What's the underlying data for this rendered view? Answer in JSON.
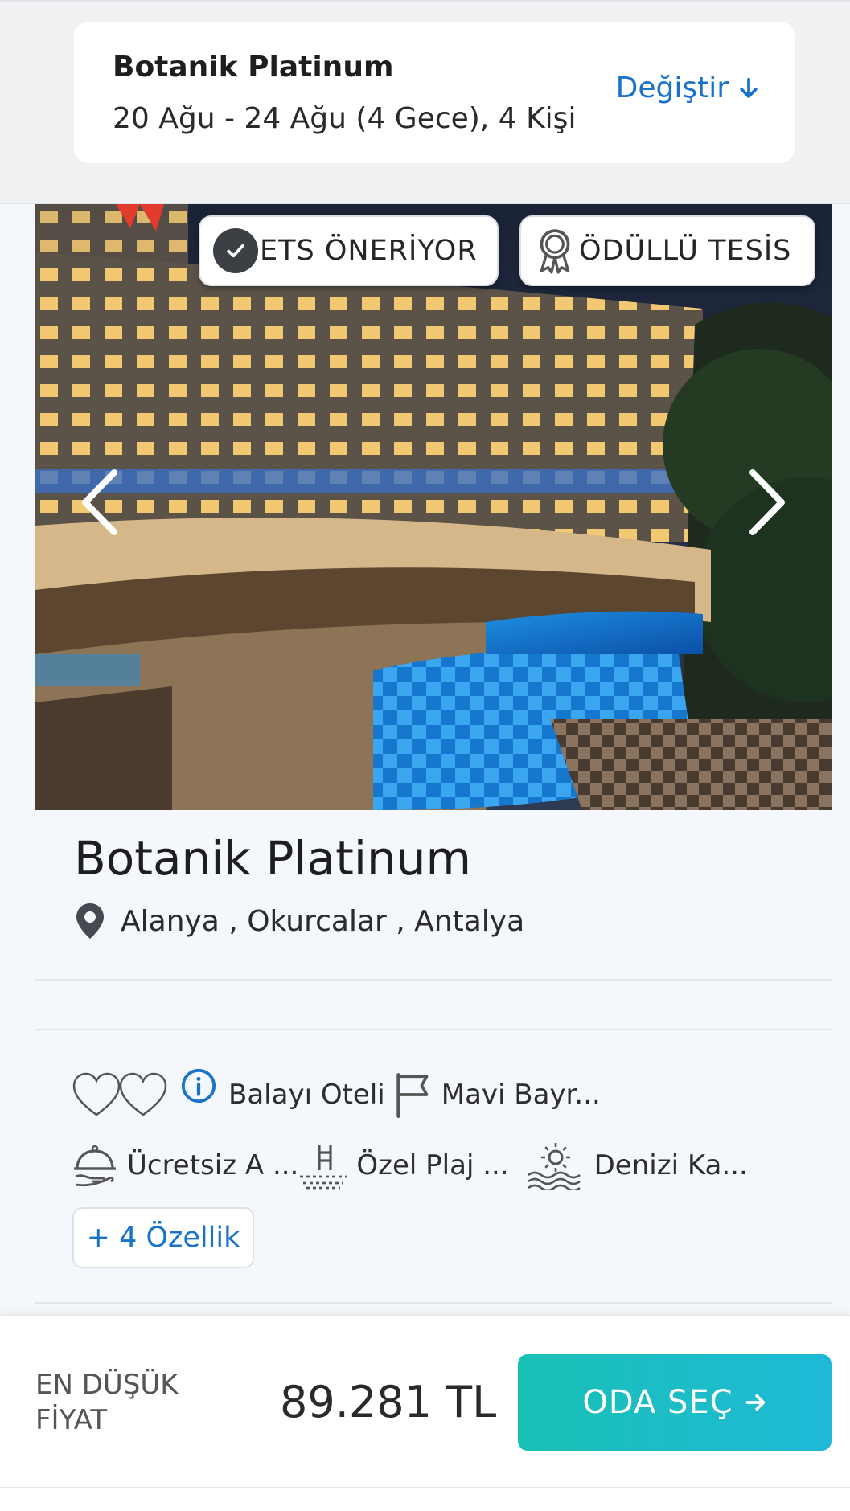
{
  "summary": {
    "hotel_name": "Botanik Platinum",
    "dates": "20 Ağu - 24 Ağu (4 Gece), 4 Kişi",
    "change_label": "Değiştir",
    "change_icon": "arrow-down-icon"
  },
  "gallery": {
    "badges": [
      {
        "label": "ETS ÖNERİYOR",
        "icon": "check-circle-icon"
      },
      {
        "label": "ÖDÜLLÜ TESİS",
        "icon": "award-icon"
      }
    ],
    "prev_icon": "chevron-left-icon",
    "next_icon": "chevron-right-icon"
  },
  "hotel": {
    "title": "Botanik Platinum",
    "location": "Alanya , Okurcalar , Antalya"
  },
  "features": {
    "row1": [
      {
        "label": "Balayı Oteli",
        "icon": "hearts-icon"
      },
      {
        "label": "Mavi Bayr...",
        "icon": "flag-icon"
      }
    ],
    "row2": [
      {
        "label": "Ücretsiz A ...",
        "icon": "room-service-icon"
      },
      {
        "label": "Özel Plaj ...",
        "icon": "beach-ladder-icon"
      },
      {
        "label": "Denizi Ka...",
        "icon": "sea-sun-icon"
      }
    ],
    "more_label": "+ 4 Özellik"
  },
  "footer": {
    "price_label": "EN DÜŞÜK FİYAT",
    "price_value": "89.281 TL",
    "select_label": "ODA SEÇ",
    "select_icon": "arrow-right-icon"
  },
  "colors": {
    "accent_blue": "#1a73c9",
    "button_gradient_start": "#19c0b5",
    "button_gradient_end": "#1fb9d8"
  }
}
